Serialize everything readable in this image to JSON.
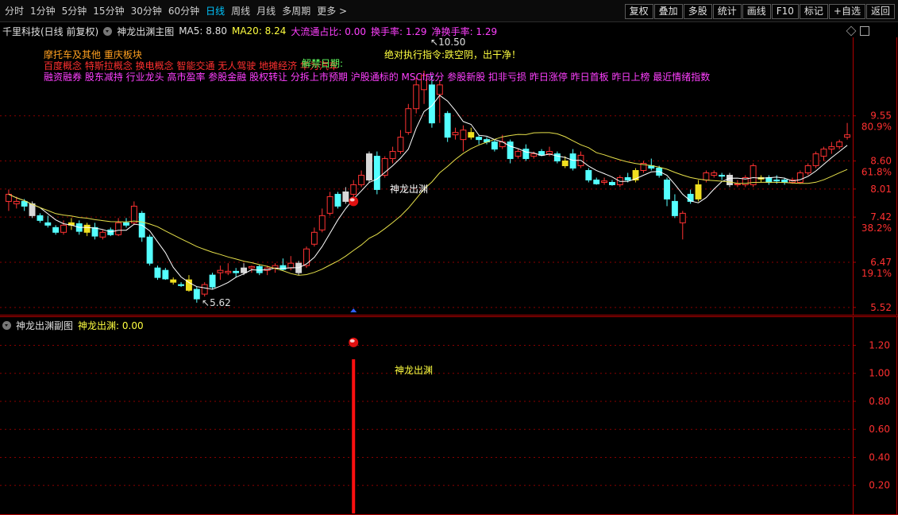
{
  "toolbar": {
    "timeframes": [
      {
        "label": "分时",
        "active": false
      },
      {
        "label": "1分钟",
        "active": false
      },
      {
        "label": "5分钟",
        "active": false
      },
      {
        "label": "15分钟",
        "active": false
      },
      {
        "label": "30分钟",
        "active": false
      },
      {
        "label": "60分钟",
        "active": false
      },
      {
        "label": "日线",
        "active": true
      },
      {
        "label": "周线",
        "active": false
      },
      {
        "label": "月线",
        "active": false
      },
      {
        "label": "多周期",
        "active": false
      },
      {
        "label": "更多 >",
        "active": false
      }
    ],
    "right_buttons": [
      "复权",
      "叠加",
      "多股",
      "统计",
      "画线",
      "F10",
      "标记",
      "+自选",
      "返回"
    ]
  },
  "info": {
    "stock": "千里科技(日线 前复权)",
    "indicator": "神龙出渊主图",
    "ma5": "MA5: 8.80",
    "ma20": "MA20: 8.24",
    "flow": "大流通占比: 0.00",
    "turnover": "换手率: 1.29",
    "net_turnover": "净换手率: 1.29"
  },
  "overlay": {
    "line1": "摩托车及其他 重庆板块",
    "line2": "百度概念 特斯拉概念 换电概念 智能交通 无人驾驶 地摊经济 华为汽车",
    "line3": "融资融券 股东减持 行业龙头 高市盈率 参股金融 股权转让 分拆上市预期 沪股通标的 MSCI成分 参股新股 扣非亏损 昨日涨停 昨日首板 昨日上榜 最近情绪指数",
    "unlock": "解禁日期:",
    "warning": "绝对执行指令:跌空阴，出干净！"
  },
  "annotations": {
    "high": "10.50",
    "low": "5.62",
    "signal_main": "神龙出渊",
    "signal_sub": "神龙出渊"
  },
  "price_axis": {
    "ticks": [
      {
        "label": "9.55",
        "pct": "80.9%"
      },
      {
        "label": "8.60",
        "pct": "61.8%"
      },
      {
        "label": "8.01",
        "pct": ""
      },
      {
        "label": "7.42",
        "pct": "38.2%"
      },
      {
        "label": "6.47",
        "pct": "19.1%"
      },
      {
        "label": "5.52",
        "pct": ""
      }
    ]
  },
  "sub_panel": {
    "indicator": "神龙出渊副图",
    "value": "神龙出渊: 0.00",
    "ticks": [
      "1.20",
      "1.00",
      "0.80",
      "0.60",
      "0.40",
      "0.20"
    ]
  },
  "colors": {
    "up": "#ff3232",
    "down": "#54ffff",
    "gold": "#f0e020",
    "ma5": "#ffffff",
    "ma20": "#e6e04a",
    "grid": "#8a0000",
    "axis": "#b00000"
  },
  "chart_data": {
    "type": "candlestick",
    "ylim": [
      5.35,
      11.2
    ],
    "indicator_ylim": [
      0,
      1.35
    ],
    "signal_index": 44,
    "signal_value": 1.1,
    "candles": [
      {
        "o": 7.75,
        "h": 8.0,
        "l": 7.55,
        "c": 7.9
      },
      {
        "o": 7.7,
        "h": 7.85,
        "l": 7.6,
        "c": 7.75
      },
      {
        "o": 7.75,
        "h": 7.8,
        "l": 7.55,
        "c": 7.65
      },
      {
        "o": 7.7,
        "h": 7.75,
        "l": 7.4,
        "c": 7.45
      },
      {
        "o": 7.45,
        "h": 7.5,
        "l": 7.3,
        "c": 7.35
      },
      {
        "o": 7.3,
        "h": 7.45,
        "l": 7.2,
        "c": 7.25
      },
      {
        "o": 7.2,
        "h": 7.25,
        "l": 7.05,
        "c": 7.1
      },
      {
        "o": 7.1,
        "h": 7.35,
        "l": 7.05,
        "c": 7.25
      },
      {
        "o": 7.25,
        "h": 7.4,
        "l": 7.15,
        "c": 7.3
      },
      {
        "o": 7.28,
        "h": 7.35,
        "l": 7.05,
        "c": 7.12
      },
      {
        "o": 7.1,
        "h": 7.3,
        "l": 7.02,
        "c": 7.25
      },
      {
        "o": 7.2,
        "h": 7.3,
        "l": 6.95,
        "c": 7.02
      },
      {
        "o": 7.0,
        "h": 7.15,
        "l": 6.95,
        "c": 7.1
      },
      {
        "o": 7.15,
        "h": 7.2,
        "l": 7.02,
        "c": 7.05
      },
      {
        "o": 7.05,
        "h": 7.4,
        "l": 7.02,
        "c": 7.3
      },
      {
        "o": 7.3,
        "h": 7.4,
        "l": 7.2,
        "c": 7.25
      },
      {
        "o": 7.3,
        "h": 7.75,
        "l": 7.25,
        "c": 7.65
      },
      {
        "o": 7.5,
        "h": 7.55,
        "l": 6.9,
        "c": 7.0
      },
      {
        "o": 7.0,
        "h": 7.05,
        "l": 6.4,
        "c": 6.45
      },
      {
        "o": 6.35,
        "h": 6.4,
        "l": 6.1,
        "c": 6.15
      },
      {
        "o": 6.3,
        "h": 6.35,
        "l": 6.1,
        "c": 6.12
      },
      {
        "o": 6.05,
        "h": 6.15,
        "l": 6.0,
        "c": 6.1
      },
      {
        "o": 6.0,
        "h": 6.05,
        "l": 5.95,
        "c": 5.98
      },
      {
        "o": 6.1,
        "h": 6.2,
        "l": 5.85,
        "c": 5.88
      },
      {
        "o": 5.9,
        "h": 5.95,
        "l": 5.62,
        "c": 5.7
      },
      {
        "o": 5.8,
        "h": 6.05,
        "l": 5.75,
        "c": 6.0
      },
      {
        "o": 6.2,
        "h": 6.25,
        "l": 5.9,
        "c": 5.95
      },
      {
        "o": 6.25,
        "h": 6.4,
        "l": 6.1,
        "c": 6.3
      },
      {
        "o": 6.25,
        "h": 6.45,
        "l": 6.2,
        "c": 6.28
      },
      {
        "o": 6.28,
        "h": 6.35,
        "l": 6.15,
        "c": 6.25
      },
      {
        "o": 6.25,
        "h": 6.45,
        "l": 6.2,
        "c": 6.35
      },
      {
        "o": 6.35,
        "h": 6.4,
        "l": 6.25,
        "c": 6.38
      },
      {
        "o": 6.38,
        "h": 6.42,
        "l": 6.2,
        "c": 6.25
      },
      {
        "o": 6.3,
        "h": 6.4,
        "l": 6.2,
        "c": 6.35
      },
      {
        "o": 6.35,
        "h": 6.45,
        "l": 6.25,
        "c": 6.4
      },
      {
        "o": 6.4,
        "h": 6.55,
        "l": 6.3,
        "c": 6.32
      },
      {
        "o": 6.35,
        "h": 6.6,
        "l": 6.3,
        "c": 6.45
      },
      {
        "o": 6.45,
        "h": 6.5,
        "l": 6.2,
        "c": 6.25
      },
      {
        "o": 6.4,
        "h": 6.8,
        "l": 6.35,
        "c": 6.75
      },
      {
        "o": 6.85,
        "h": 7.2,
        "l": 6.8,
        "c": 7.1
      },
      {
        "o": 7.15,
        "h": 7.6,
        "l": 7.1,
        "c": 7.45
      },
      {
        "o": 7.5,
        "h": 7.95,
        "l": 7.45,
        "c": 7.85
      },
      {
        "o": 7.9,
        "h": 7.95,
        "l": 7.6,
        "c": 7.65
      },
      {
        "o": 7.75,
        "h": 8.05,
        "l": 7.7,
        "c": 7.95
      },
      {
        "o": 7.9,
        "h": 8.2,
        "l": 7.85,
        "c": 8.1
      },
      {
        "o": 8.1,
        "h": 8.4,
        "l": 8.05,
        "c": 8.3
      },
      {
        "o": 8.2,
        "h": 8.8,
        "l": 8.15,
        "c": 8.75
      },
      {
        "o": 8.7,
        "h": 8.8,
        "l": 7.9,
        "c": 8.0
      },
      {
        "o": 8.3,
        "h": 8.7,
        "l": 8.25,
        "c": 8.65
      },
      {
        "o": 8.65,
        "h": 8.9,
        "l": 8.55,
        "c": 8.8
      },
      {
        "o": 8.8,
        "h": 9.25,
        "l": 8.75,
        "c": 9.1
      },
      {
        "o": 9.2,
        "h": 9.8,
        "l": 9.15,
        "c": 9.7
      },
      {
        "o": 9.7,
        "h": 10.35,
        "l": 9.6,
        "c": 10.2
      },
      {
        "o": 10.1,
        "h": 10.5,
        "l": 9.8,
        "c": 10.4
      },
      {
        "o": 10.2,
        "h": 10.4,
        "l": 9.3,
        "c": 9.4
      },
      {
        "o": 10.0,
        "h": 10.3,
        "l": 9.4,
        "c": 10.2
      },
      {
        "o": 9.6,
        "h": 9.65,
        "l": 9.0,
        "c": 9.1
      },
      {
        "o": 9.15,
        "h": 9.3,
        "l": 9.05,
        "c": 9.2
      },
      {
        "o": 9.05,
        "h": 9.35,
        "l": 8.8,
        "c": 9.25
      },
      {
        "o": 9.2,
        "h": 9.3,
        "l": 9.05,
        "c": 9.1
      },
      {
        "o": 9.1,
        "h": 9.15,
        "l": 8.95,
        "c": 9.05
      },
      {
        "o": 9.05,
        "h": 9.1,
        "l": 8.95,
        "c": 9.0
      },
      {
        "o": 9.0,
        "h": 9.05,
        "l": 8.8,
        "c": 8.85
      },
      {
        "o": 8.9,
        "h": 9.15,
        "l": 8.85,
        "c": 9.0
      },
      {
        "o": 9.0,
        "h": 9.05,
        "l": 8.55,
        "c": 8.65
      },
      {
        "o": 8.7,
        "h": 8.85,
        "l": 8.65,
        "c": 8.8
      },
      {
        "o": 8.85,
        "h": 8.95,
        "l": 8.6,
        "c": 8.65
      },
      {
        "o": 8.7,
        "h": 8.8,
        "l": 8.65,
        "c": 8.75
      },
      {
        "o": 8.8,
        "h": 8.85,
        "l": 8.7,
        "c": 8.72
      },
      {
        "o": 8.75,
        "h": 8.9,
        "l": 8.7,
        "c": 8.8
      },
      {
        "o": 8.75,
        "h": 8.8,
        "l": 8.55,
        "c": 8.6
      },
      {
        "o": 8.6,
        "h": 8.7,
        "l": 8.45,
        "c": 8.5
      },
      {
        "o": 8.75,
        "h": 8.85,
        "l": 8.4,
        "c": 8.45
      },
      {
        "o": 8.5,
        "h": 8.8,
        "l": 8.45,
        "c": 8.72
      },
      {
        "o": 8.4,
        "h": 8.45,
        "l": 8.15,
        "c": 8.2
      },
      {
        "o": 8.2,
        "h": 8.25,
        "l": 8.1,
        "c": 8.12
      },
      {
        "o": 8.15,
        "h": 8.25,
        "l": 8.1,
        "c": 8.18
      },
      {
        "o": 8.15,
        "h": 8.2,
        "l": 8.08,
        "c": 8.1
      },
      {
        "o": 8.1,
        "h": 8.3,
        "l": 8.05,
        "c": 8.25
      },
      {
        "o": 8.25,
        "h": 8.35,
        "l": 8.15,
        "c": 8.2
      },
      {
        "o": 8.2,
        "h": 8.45,
        "l": 8.15,
        "c": 8.4
      },
      {
        "o": 8.4,
        "h": 8.6,
        "l": 8.35,
        "c": 8.55
      },
      {
        "o": 8.5,
        "h": 8.65,
        "l": 8.4,
        "c": 8.45
      },
      {
        "o": 8.45,
        "h": 8.5,
        "l": 8.25,
        "c": 8.3
      },
      {
        "o": 8.2,
        "h": 8.25,
        "l": 7.65,
        "c": 7.8
      },
      {
        "o": 7.75,
        "h": 7.9,
        "l": 7.4,
        "c": 7.45
      },
      {
        "o": 7.3,
        "h": 7.55,
        "l": 6.95,
        "c": 7.5
      },
      {
        "o": 7.9,
        "h": 8.0,
        "l": 7.7,
        "c": 7.75
      },
      {
        "o": 7.8,
        "h": 8.2,
        "l": 7.75,
        "c": 8.1
      },
      {
        "o": 8.2,
        "h": 8.4,
        "l": 8.15,
        "c": 8.35
      },
      {
        "o": 8.3,
        "h": 8.4,
        "l": 8.25,
        "c": 8.35
      },
      {
        "o": 8.3,
        "h": 8.35,
        "l": 8.2,
        "c": 8.28
      },
      {
        "o": 8.3,
        "h": 8.35,
        "l": 8.05,
        "c": 8.1
      },
      {
        "o": 8.1,
        "h": 8.2,
        "l": 8.05,
        "c": 8.12
      },
      {
        "o": 8.1,
        "h": 8.3,
        "l": 8.05,
        "c": 8.25
      },
      {
        "o": 8.1,
        "h": 8.55,
        "l": 8.05,
        "c": 8.5
      },
      {
        "o": 8.25,
        "h": 8.3,
        "l": 8.15,
        "c": 8.22
      },
      {
        "o": 8.25,
        "h": 8.3,
        "l": 8.1,
        "c": 8.15
      },
      {
        "o": 8.2,
        "h": 8.3,
        "l": 8.12,
        "c": 8.18
      },
      {
        "o": 8.2,
        "h": 8.25,
        "l": 8.1,
        "c": 8.15
      },
      {
        "o": 8.15,
        "h": 8.25,
        "l": 8.12,
        "c": 8.2
      },
      {
        "o": 8.15,
        "h": 8.4,
        "l": 8.12,
        "c": 8.35
      },
      {
        "o": 8.35,
        "h": 8.55,
        "l": 8.3,
        "c": 8.5
      },
      {
        "o": 8.5,
        "h": 8.8,
        "l": 8.45,
        "c": 8.75
      },
      {
        "o": 8.7,
        "h": 8.9,
        "l": 8.6,
        "c": 8.85
      },
      {
        "o": 8.85,
        "h": 9.0,
        "l": 8.75,
        "c": 8.9
      },
      {
        "o": 8.9,
        "h": 9.05,
        "l": 8.85,
        "c": 9.0
      },
      {
        "o": 9.1,
        "h": 9.4,
        "l": 9.05,
        "c": 9.15
      }
    ]
  }
}
